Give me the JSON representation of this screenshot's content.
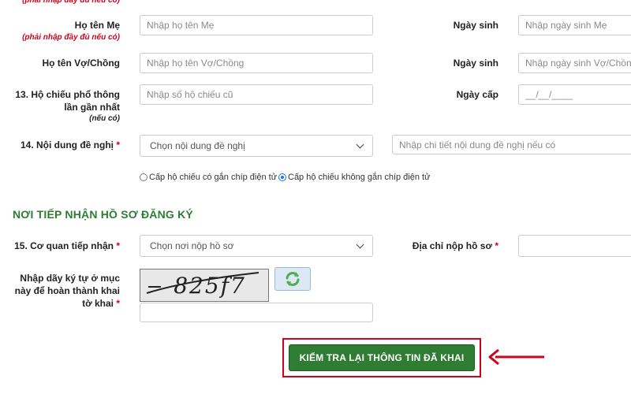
{
  "top_note": "(phải nhập đầy đủ nếu có)",
  "mother": {
    "label": "Họ tên Mẹ",
    "note": "(phải nhập đầy đủ nếu có)",
    "name_placeholder": "Nhập họ tên Mẹ",
    "dob_label": "Ngày sinh",
    "dob_placeholder": "Nhập ngày sinh Mẹ"
  },
  "spouse": {
    "label": "Họ tên Vợ/Chồng",
    "name_placeholder": "Nhập họ tên Vợ/Chồng",
    "dob_label": "Ngày sinh",
    "dob_placeholder": "Nhập ngày sinh Vợ/Chồng"
  },
  "passport": {
    "label_line1": "13. Hộ chiếu phổ thông",
    "label_line2": "lần gần nhất",
    "note": "(nếu có)",
    "number_placeholder": "Nhập số hộ chiếu cũ",
    "issue_label": "Ngày cấp",
    "issue_placeholder": "__/__/____"
  },
  "request": {
    "label": "14. Nội dung đề nghị",
    "required_mark": "*",
    "select_value": "Chọn nội dung đề nghị",
    "detail_placeholder": "Nhập chi tiết nội dung đề nghị nếu có",
    "radio_chip": "Cấp hộ chiếu có gắn chíp điện tử",
    "radio_no_chip": "Cấp hộ chiếu không gắn chíp điện tử"
  },
  "section_title": "NƠI TIẾP NHẬN HỒ SƠ ĐĂNG KÝ",
  "agency": {
    "label": "15. Cơ quan tiếp nhận",
    "required_mark": "*",
    "select_value": "Chọn nơi nộp hồ sơ",
    "address_label": "Địa chỉ nộp hồ sơ",
    "address_required_mark": "*"
  },
  "captcha": {
    "label_line1": "Nhập dãy ký tự ở mục",
    "label_line2": "này để hoàn thành khai",
    "label_line3": "tờ khai",
    "required_mark": "*",
    "image_text": "825f7"
  },
  "submit_label": "KIỂM TRA LẠI THÔNG TIN ĐÃ KHAI",
  "colors": {
    "accent_green": "#2e7d32",
    "required_red": "#d0021b",
    "annotation_red": "#d0021b"
  }
}
